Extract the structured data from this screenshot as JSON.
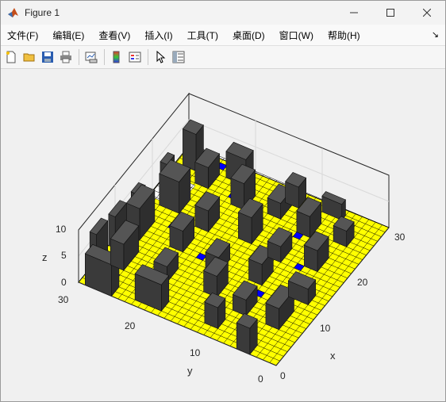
{
  "window": {
    "title": "Figure 1"
  },
  "menu": [
    "文件(F)",
    "编辑(E)",
    "查看(V)",
    "插入(I)",
    "工具(T)",
    "桌面(D)",
    "窗口(W)",
    "帮助(H)"
  ],
  "toolbar": [
    "new-figure",
    "open-file",
    "save",
    "print",
    "link-plot",
    "insert-colorbar",
    "insert-legend",
    "edit-plot",
    "property-inspector"
  ],
  "axes": {
    "x_label": "x",
    "y_label": "y",
    "z_label": "z",
    "x_ticks": [
      "0",
      "10",
      "20",
      "30"
    ],
    "y_ticks": [
      "10",
      "20",
      "30"
    ],
    "y_origin_tick": "0",
    "z_ticks": [
      "0",
      "5",
      "10"
    ]
  },
  "colors": {
    "floor": "#ffff00",
    "floor_alt": "#ffffff",
    "grid": "#000000",
    "block": "#3c3c3c",
    "marker": "#0000ff",
    "axes_bg": "#f0f0f0"
  }
}
